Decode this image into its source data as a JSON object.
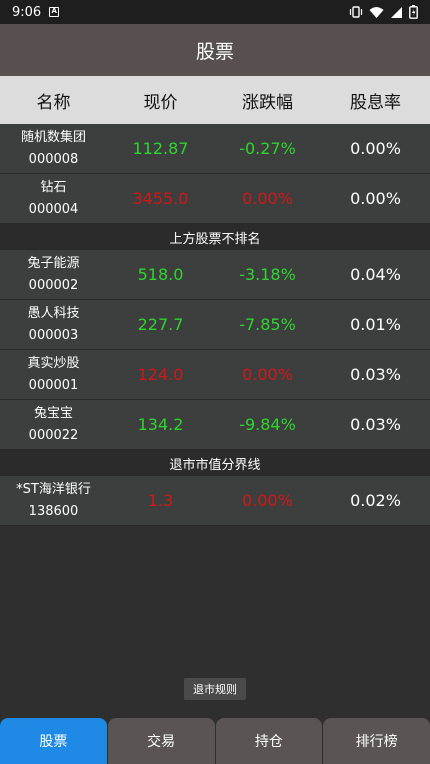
{
  "status": {
    "time": "9:06",
    "notif_letter": "A"
  },
  "appbar": {
    "title": "股票"
  },
  "table": {
    "headers": [
      "名称",
      "现价",
      "涨跌幅",
      "股息率"
    ],
    "rows": [
      {
        "name": "随机数集团",
        "code": "000008",
        "price": "112.87",
        "change": "-0.27%",
        "yield": "0.00%",
        "color": "green"
      },
      {
        "name": "钻石",
        "code": "000004",
        "price": "3455.0",
        "change": "0.00%",
        "yield": "0.00%",
        "color": "red"
      },
      {
        "divider": "上方股票不排名"
      },
      {
        "name": "兔子能源",
        "code": "000002",
        "price": "518.0",
        "change": "-3.18%",
        "yield": "0.04%",
        "color": "green"
      },
      {
        "name": "愚人科技",
        "code": "000003",
        "price": "227.7",
        "change": "-7.85%",
        "yield": "0.01%",
        "color": "green"
      },
      {
        "name": "真实炒股",
        "code": "000001",
        "price": "124.0",
        "change": "0.00%",
        "yield": "0.03%",
        "color": "red"
      },
      {
        "name": "兔宝宝",
        "code": "000022",
        "price": "134.2",
        "change": "-9.84%",
        "yield": "0.03%",
        "color": "green"
      },
      {
        "divider": "退市市值分界线"
      },
      {
        "name": "*ST海洋银行",
        "code": "138600",
        "price": "1.3",
        "change": "0.00%",
        "yield": "0.02%",
        "color": "red"
      }
    ]
  },
  "rules_button": "退市规则",
  "tabs": [
    {
      "label": "股票",
      "active": true
    },
    {
      "label": "交易",
      "active": false
    },
    {
      "label": "持仓",
      "active": false
    },
    {
      "label": "排行榜",
      "active": false
    }
  ],
  "colors": {
    "up_green": "#2ed52e",
    "down_red": "#d01818",
    "accent": "#1e8ae6"
  }
}
